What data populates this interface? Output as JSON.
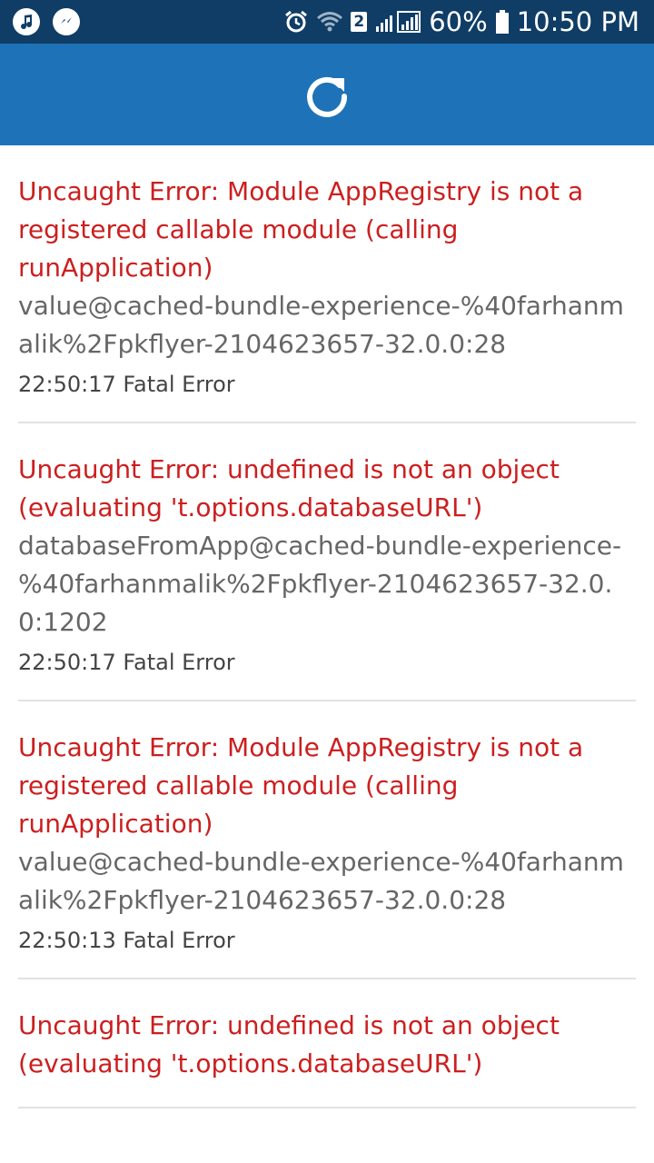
{
  "status_bar": {
    "left_icons": [
      "music-note-icon",
      "messenger-icon"
    ],
    "right_icons": [
      "alarm-icon",
      "wifi-icon",
      "cell-signal-icon",
      "battery-icon"
    ],
    "sim_badge": "2",
    "battery": "60%",
    "time": "10:50 PM",
    "background": "#0f3d66"
  },
  "toolbar": {
    "background": "#1e73b8",
    "reload_icon": "reload-icon"
  },
  "logs": [
    {
      "message": "Uncaught Error: Module AppRegistry is not a registered callable module (calling runApplication)",
      "stack": "value@cached-bundle-experience-%40farhanmalik%2Fpkflyer-2104623657-32.0.0:28",
      "meta": "22:50:17 Fatal Error"
    },
    {
      "message": "Uncaught Error: undefined is not an object (evaluating 't.options.databaseURL')",
      "stack": "databaseFromApp@cached-bundle-experience-%40farhanmalik%2Fpkflyer-2104623657-32.0.0:1202",
      "meta": "22:50:17 Fatal Error"
    },
    {
      "message": "Uncaught Error: Module AppRegistry is not a registered callable module (calling runApplication)",
      "stack": "value@cached-bundle-experience-%40farhanmalik%2Fpkflyer-2104623657-32.0.0:28",
      "meta": "22:50:13 Fatal Error"
    },
    {
      "message": "Uncaught Error: undefined is not an object (evaluating 't.options.databaseURL')",
      "stack": "",
      "meta": ""
    }
  ],
  "colors": {
    "error_text": "#cc1f1f",
    "stack_text": "#666666"
  }
}
